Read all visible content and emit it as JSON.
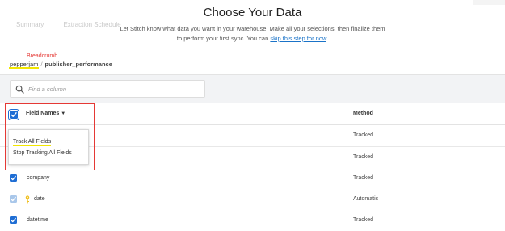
{
  "header": {
    "title": "Choose Your Data",
    "subtitle_line1": "Let Stitch know what data you want in your warehouse. Make all your selections, then finalize them",
    "subtitle_line2_prefix": "to perform your first sync. You can ",
    "subtitle_link": "skip this step for now",
    "subtitle_suffix": ".",
    "ghost_tabs": [
      "Summary",
      "Extraction Schedule"
    ]
  },
  "annotation": {
    "label": "Breadcrumb",
    "color": "#e53935"
  },
  "breadcrumb": {
    "parent": "pepperjam",
    "separator": "/",
    "current": "publisher_performance"
  },
  "search": {
    "placeholder": "Find a column",
    "icon": "search-icon"
  },
  "table": {
    "columns": {
      "field": "Field Names",
      "method": "Method"
    },
    "header_checkbox_checked": true,
    "rows": [
      {
        "name": "",
        "method": "Tracked",
        "checked": true
      },
      {
        "name": "",
        "method": "Tracked",
        "checked": true
      },
      {
        "name": "company",
        "method": "Tracked",
        "checked": true
      },
      {
        "name": "date",
        "method": "Automatic",
        "checked": true,
        "primary_key": true
      },
      {
        "name": "datetime",
        "method": "Tracked",
        "checked": true
      }
    ]
  },
  "dropdown": {
    "items": [
      "Track All Fields",
      "Stop Tracking All Fields"
    ]
  },
  "colors": {
    "accent": "#1f6ed4",
    "highlight": "#f2e600",
    "toolbar_bg": "#f2f3f5"
  }
}
